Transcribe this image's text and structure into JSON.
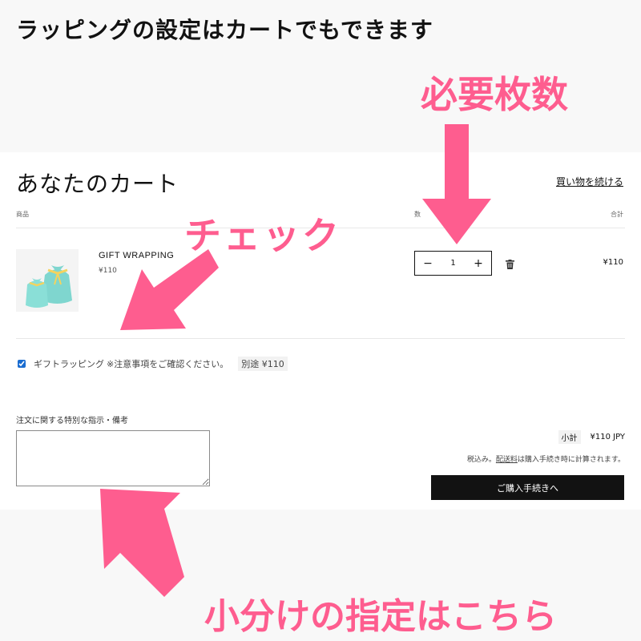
{
  "heading": "ラッピングの設定はカートでもできます",
  "cart": {
    "title": "あなたのカート",
    "continue_link": "買い物を続ける",
    "columns": {
      "product": "商品",
      "quantity": "数",
      "total": "合計"
    },
    "item": {
      "name": "GIFT WRAPPING",
      "price": "¥110",
      "quantity": "1",
      "line_total": "¥110",
      "minus": "−",
      "plus": "+"
    },
    "wrapping_option": {
      "checked": true,
      "label": "ギフトラッピング",
      "note": "※注意事項をご確認ください。",
      "price": "別途 ¥110"
    },
    "notes_label": "注文に関する特別な指示・備考",
    "subtotal_label": "小計",
    "subtotal_value": "¥110 JPY",
    "tax_note_prefix": "税込み。",
    "tax_note_link": "配送料",
    "tax_note_suffix": "は購入手続き時に計算されます。",
    "checkout_label": "ご購入手続きへ"
  },
  "callouts": {
    "quantity": "必要枚数",
    "check": "チェック",
    "notes": "小分けの指定はこちら"
  },
  "colors": {
    "accent_pink": "#fe5d8f",
    "button_dark": "#121212",
    "wrap_bag": "#7fd6cf",
    "ribbon": "#f4d35e"
  }
}
